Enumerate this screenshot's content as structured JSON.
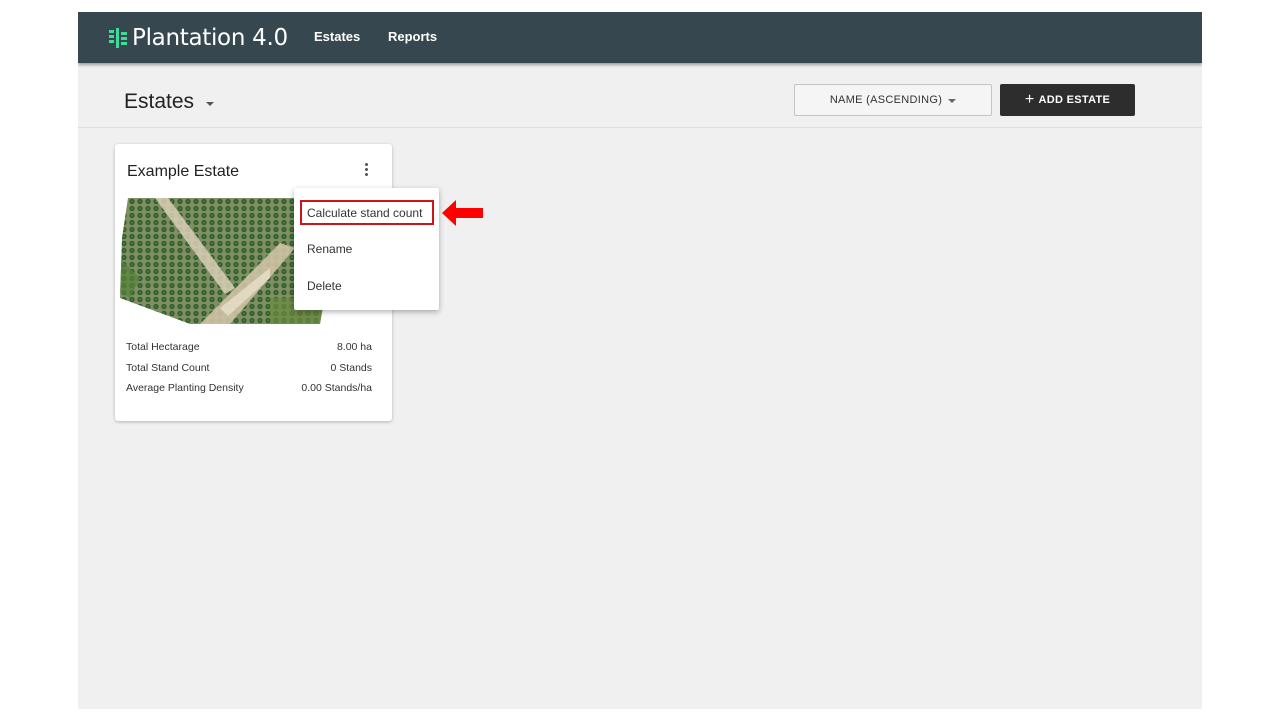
{
  "app": {
    "brand_name": "Plantation 4.0",
    "brand_color": "#3ddc97",
    "nav": [
      {
        "label": "Estates"
      },
      {
        "label": "Reports"
      }
    ]
  },
  "header": {
    "title": "Estates",
    "sort_label": "NAME (ASCENDING)",
    "add_label": "ADD ESTATE"
  },
  "card": {
    "title": "Example Estate",
    "stats": [
      {
        "label": "Total Hectarage",
        "value": "8.00 ha"
      },
      {
        "label": "Total Stand Count",
        "value": "0 Stands"
      },
      {
        "label": "Average Planting Density",
        "value": "0.00 Stands/ha"
      }
    ]
  },
  "menu": {
    "items": [
      {
        "label": "Calculate stand count"
      },
      {
        "label": "Rename"
      },
      {
        "label": "Delete"
      }
    ]
  },
  "colors": {
    "topbar": "#37474f",
    "highlight": "#d0121b",
    "add_button": "#2d2d2d"
  },
  "icons": {
    "brand": "plantation-logo-icon",
    "kebab": "more-vertical-icon",
    "arrow": "left-arrow-icon",
    "plus": "plus-icon"
  }
}
